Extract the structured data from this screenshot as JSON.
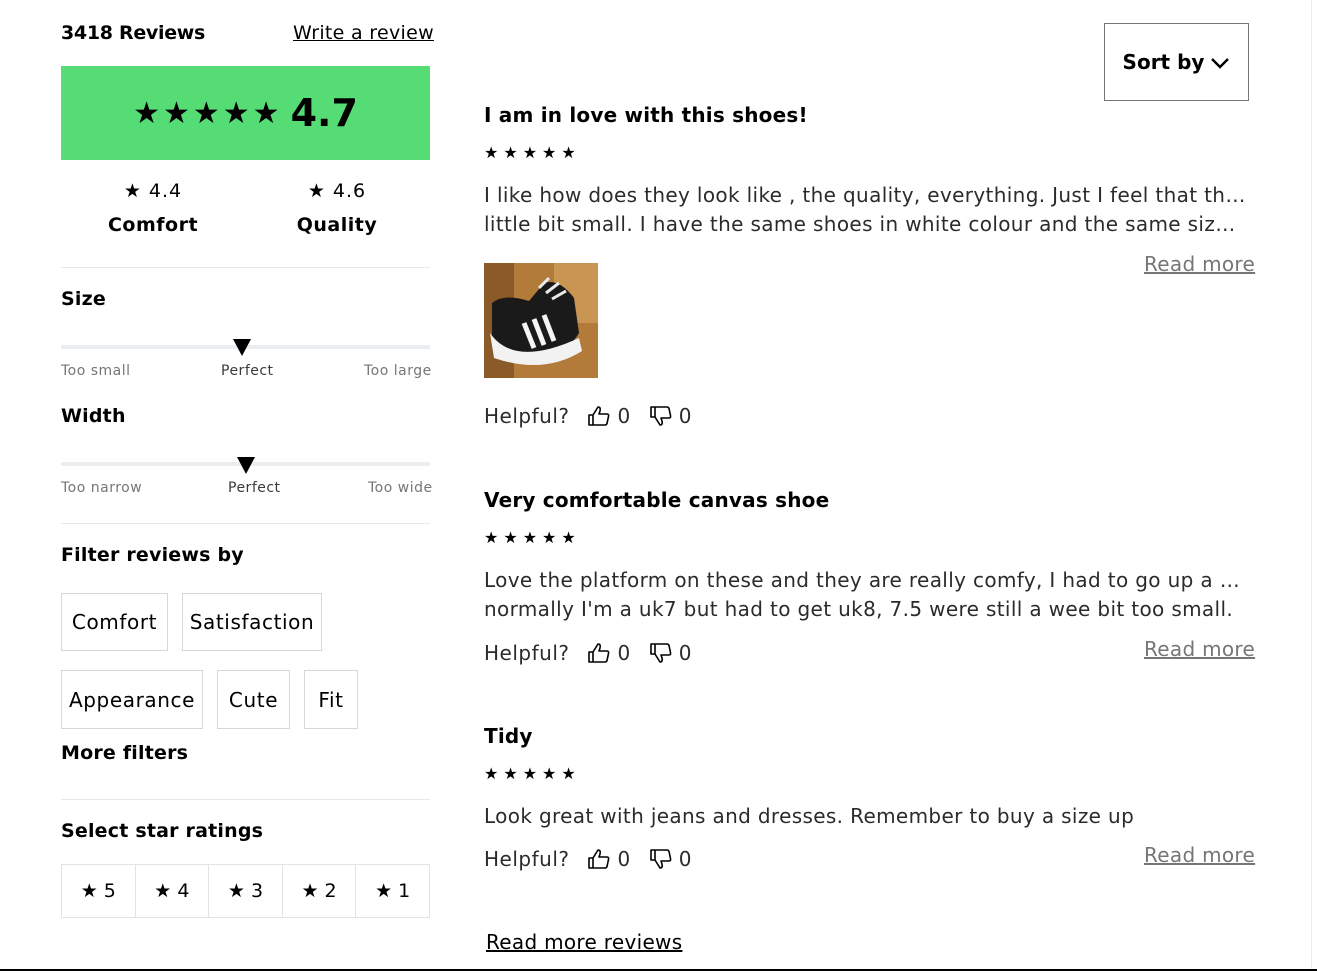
{
  "summary": {
    "review_count": "3418 Reviews",
    "write_review": "Write a review",
    "overall_stars": "★★★★★",
    "overall_score": "4.7",
    "accent_color": "#55dc74",
    "comfort": {
      "value": "★ 4.4",
      "label": "Comfort"
    },
    "quality": {
      "value": "★ 4.6",
      "label": "Quality"
    }
  },
  "size": {
    "title": "Size",
    "level": 0.49,
    "left": "Too small",
    "mid": "Perfect",
    "right": "Too large"
  },
  "width": {
    "title": "Width",
    "level": 0.5,
    "left": "Too narrow",
    "mid": "Perfect",
    "right": "Too wide"
  },
  "filters": {
    "title": "Filter reviews by",
    "chips": [
      "Comfort",
      "Satisfaction",
      "Appearance",
      "Cute",
      "Fit"
    ],
    "more": "More filters"
  },
  "star_filter": {
    "title": "Select star ratings",
    "options": [
      "★ 5",
      "★ 4",
      "★ 3",
      "★ 2",
      "★ 1"
    ]
  },
  "sort": {
    "label": "Sort by"
  },
  "reviews": [
    {
      "title": "I am in love with this shoes!",
      "stars": "★★★★★",
      "body_line1": "I like how does they look like , the quality, everything. Just I feel that they are a",
      "body_line2": "little bit small. I have the same shoes in white colour and the same size , so th...",
      "read_more": "Read more",
      "helpful": "Helpful?",
      "up": "0",
      "down": "0"
    },
    {
      "title": "Very comfortable canvas shoe",
      "stars": "★★★★★",
      "body_line1": "Love the platform on these and they are really comfy, I had to go up a full size,",
      "body_line2": "normally I'm a uk7 but had to get uk8, 7.5 were still a wee bit too small.",
      "read_more": "Read more",
      "helpful": "Helpful?",
      "up": "0",
      "down": "0"
    },
    {
      "title": "Tidy",
      "stars": "★★★★★",
      "body_line1": "Look great with jeans and dresses. Remember to buy a size up",
      "read_more": "Read more",
      "helpful": "Helpful?",
      "up": "0",
      "down": "0"
    }
  ],
  "read_more_reviews": "Read more reviews"
}
